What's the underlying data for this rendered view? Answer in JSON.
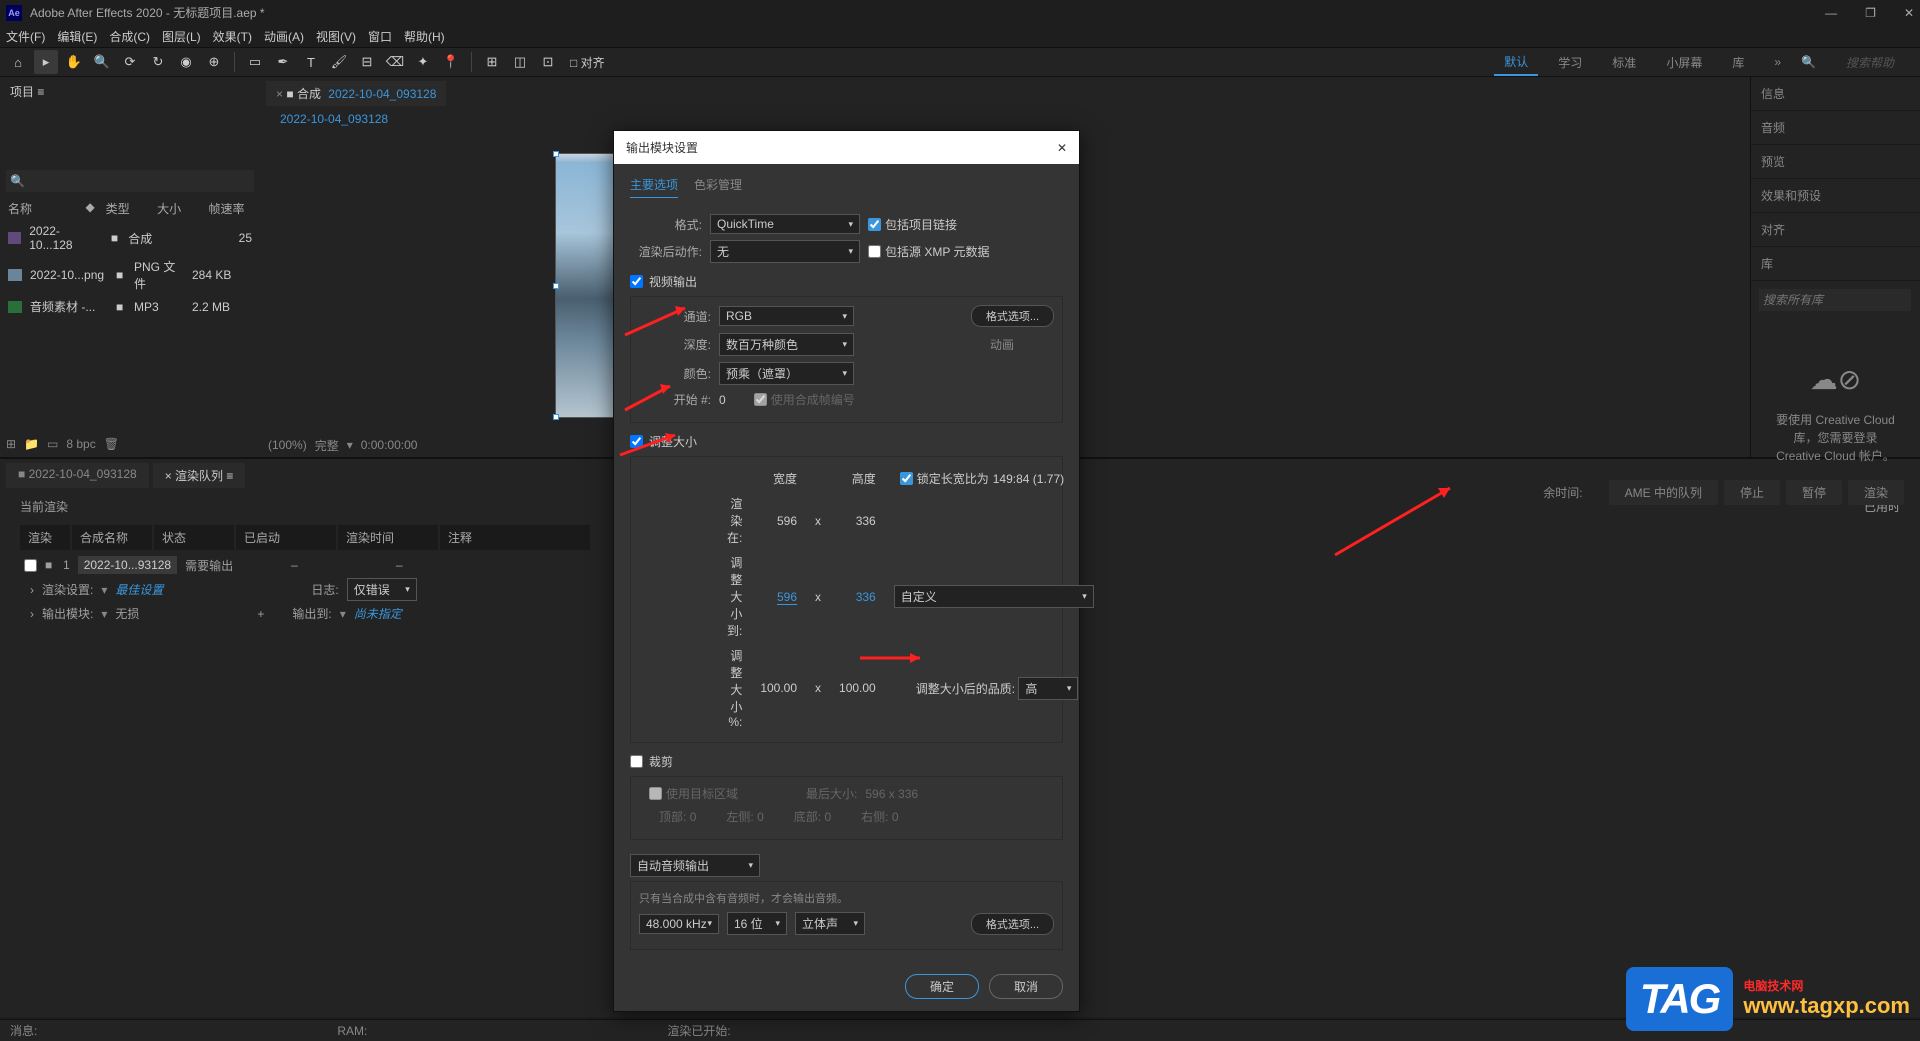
{
  "titlebar": {
    "ae_label": "Ae",
    "title": "Adobe After Effects 2020 - 无标题项目.aep *",
    "minimize": "—",
    "maximize": "❐",
    "close": "✕"
  },
  "menubar": {
    "items": [
      "文件(F)",
      "编辑(E)",
      "合成(C)",
      "图层(L)",
      "效果(T)",
      "动画(A)",
      "视图(V)",
      "窗口",
      "帮助(H)"
    ]
  },
  "toolbar": {
    "snap": "□ 对齐",
    "workspaces": [
      "默认",
      "学习",
      "标准",
      "小屏幕",
      "库"
    ],
    "search_placeholder": "搜索帮助"
  },
  "project_panel": {
    "tab": "项目 ≡",
    "header": {
      "name": "名称",
      "type": "类型",
      "size": "大小",
      "fps": "帧速率"
    },
    "rows": [
      {
        "name": "2022-10...128",
        "type": "合成",
        "size": "",
        "fps": "25"
      },
      {
        "name": "2022-10...png",
        "type": "PNG 文件",
        "size": "284 KB",
        "fps": ""
      },
      {
        "name": "音频素材 -...",
        "type": "MP3",
        "size": "2.2 MB",
        "fps": ""
      }
    ],
    "bottom_bpc": "8 bpc"
  },
  "comp_viewer": {
    "tab_prefix": "■ 合成",
    "comp_name": "2022-10-04_093128",
    "subtab": "2022-10-04_093128",
    "footer": {
      "zoom": "(100%)",
      "time": "0:00:00:00",
      "preview": "完整"
    }
  },
  "right_panels": {
    "items": [
      "信息",
      "音频",
      "预览",
      "效果和预设",
      "对齐",
      "库"
    ],
    "search_placeholder": "搜索所有库",
    "cc_msg": "要使用 Creative Cloud 库，您需要登录 Creative Cloud 帐户。"
  },
  "timeline": {
    "tabs": [
      "2022-10-04_093128",
      "× 渲染队列 ≡"
    ],
    "current_render": "当前渲染",
    "elapsed_label": "已用时",
    "remaining": "余时间:",
    "btns": {
      "ame": "AME 中的队列",
      "stop": "停止",
      "pause": "暂停",
      "render": "渲染"
    },
    "cols": [
      "渲染",
      "合成名称",
      "状态",
      "已启动",
      "渲染时间",
      "注释"
    ],
    "row": {
      "idx": "1",
      "name": "2022-10...93128",
      "status": "需要输出",
      "started": "–",
      "time": "–"
    },
    "settings_label": "渲染设置:",
    "settings_val": "最佳设置",
    "log_label": "日志:",
    "log_val": "仅错误",
    "output_label": "输出模块:",
    "output_val": "无损",
    "output_to_label": "输出到:",
    "output_to_val": "尚未指定",
    "plus": "+"
  },
  "dialog": {
    "title": "输出模块设置",
    "close": "✕",
    "tab_main": "主要选项",
    "tab_color": "色彩管理",
    "format_label": "格式:",
    "format_val": "QuickTime",
    "include_link": "包括项目链接",
    "postrender_label": "渲染后动作:",
    "postrender_val": "无",
    "include_xmp": "包括源 XMP 元数据",
    "video_output": "视频输出",
    "channel_label": "通道:",
    "channel_val": "RGB",
    "format_options": "格式选项...",
    "depth_label": "深度:",
    "depth_val": "数百万种颜色",
    "anim_label": "动画",
    "color_label": "颜色:",
    "color_val": "预乘（遮罩）",
    "start_label": "开始 #:",
    "start_val": "0",
    "use_comp_frame": "使用合成帧编号",
    "resize": "调整大小",
    "width": "宽度",
    "height": "高度",
    "lock_aspect": "锁定长宽比为",
    "aspect": "149:84 (1.77)",
    "render_at": "渲染在:",
    "render_w": "596",
    "render_h": "336",
    "x": "x",
    "resize_to": "调整大小到:",
    "resize_w": "596",
    "resize_h": "336",
    "custom": "自定义",
    "resize_pct": "调整大小 %:",
    "pct_w": "100.00",
    "pct_h": "100.00",
    "resize_quality": "调整大小后的品质:",
    "quality_val": "高",
    "crop": "裁剪",
    "use_roi": "使用目标区域",
    "final_size": "最后大小:",
    "final_dims": "596 x 336",
    "top": "顶部:",
    "left": "左侧:",
    "bottom": "底部:",
    "right": "右侧:",
    "zero": "0",
    "auto_audio": "自动音频输出",
    "audio_hint": "只有当合成中含有音频时，才会输出音频。",
    "sample": "48.000 kHz",
    "bit": "16 位",
    "stereo": "立体声",
    "ok": "确定",
    "cancel": "取消"
  },
  "statusbar": {
    "msg": "消息:",
    "ram": "RAM:",
    "render_start": "渲染已开始:"
  },
  "watermark": {
    "tag": "TAG",
    "line1": "电脑技术网",
    "url": "www.tagxp.com"
  }
}
